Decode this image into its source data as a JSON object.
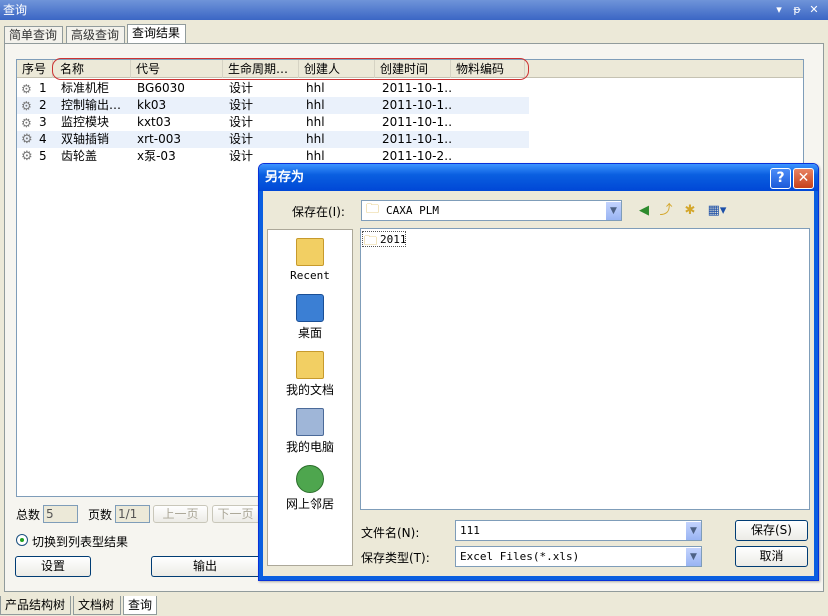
{
  "panel": {
    "title": "查询",
    "btn_menu": "▾",
    "btn_pin": "ᵽ",
    "btn_close": "✕"
  },
  "tabs": [
    "简单查询",
    "高级查询",
    "查询结果"
  ],
  "table": {
    "headers": [
      "序号",
      "名称",
      "代号",
      "生命周期…",
      "创建人",
      "创建时间",
      "物料编码"
    ],
    "rows": [
      {
        "no": "1",
        "name": "标准机柜",
        "code": "BG6030",
        "lifecycle": "设计",
        "creator": "hhl",
        "created": "2011-10-1…",
        "material": ""
      },
      {
        "no": "2",
        "name": "控制输出…",
        "code": "kk03",
        "lifecycle": "设计",
        "creator": "hhl",
        "created": "2011-10-1…",
        "material": ""
      },
      {
        "no": "3",
        "name": "监控模块",
        "code": "kxt03",
        "lifecycle": "设计",
        "creator": "hhl",
        "created": "2011-10-1…",
        "material": ""
      },
      {
        "no": "4",
        "name": "双轴插销",
        "code": "xrt-003",
        "lifecycle": "设计",
        "creator": "hhl",
        "created": "2011-10-1…",
        "material": ""
      },
      {
        "no": "5",
        "name": "齿轮盖",
        "code": "x泵-03",
        "lifecycle": "设计",
        "creator": "hhl",
        "created": "2011-10-2…",
        "material": ""
      }
    ]
  },
  "footer": {
    "total_label": "总数",
    "total_value": "5",
    "pages_label": "页数",
    "pages_value": "1/1",
    "prev_label": "上一页",
    "next_label": "下一页",
    "switch_label": "切换到列表型结果",
    "settings_label": "设置",
    "output_label": "输出"
  },
  "bottom_tabs": [
    "产品结构树",
    "文档树",
    "查询"
  ],
  "dialog": {
    "title": "另存为",
    "help_btn": "?",
    "close_btn": "✕",
    "save_in_label": "保存在(I):",
    "save_in_value": "CAXA PLM",
    "folders": [
      "2011"
    ],
    "places": [
      "Recent",
      "桌面",
      "我的文档",
      "我的电脑",
      "网上邻居"
    ],
    "filename_label": "文件名(N):",
    "filename_value": "111",
    "filetype_label": "保存类型(T):",
    "filetype_value": "Excel Files(*.xls)",
    "save_button": "保存(S)",
    "cancel_button": "取消"
  },
  "colors": {
    "accent": "#0a5fe0",
    "highlight_ring": "#cc3333",
    "row_alt": "#eaf1fb"
  }
}
